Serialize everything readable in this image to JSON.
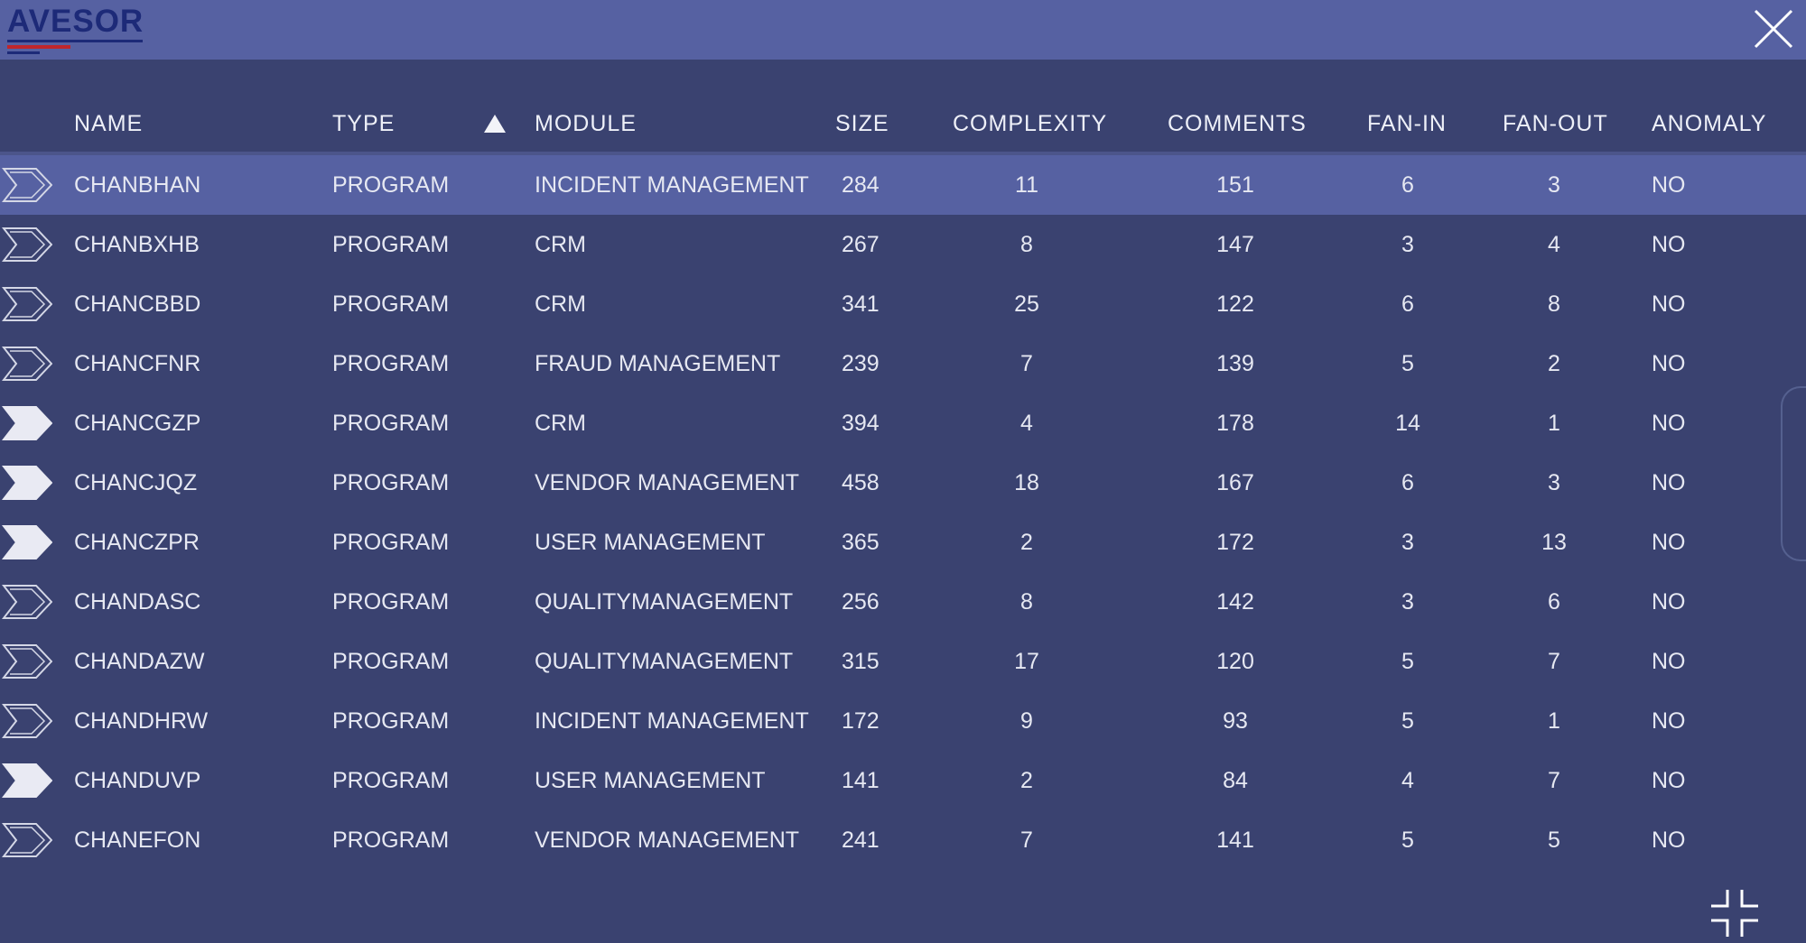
{
  "app": {
    "logo_text": "AVESOR",
    "close_icon": "close-icon",
    "collapse_icon": "collapse-icon"
  },
  "colors": {
    "background": "#3a4270",
    "header_bar": "#5661a2",
    "selected_row": "#5661a2",
    "text": "#e6e8f2",
    "logo_blue": "#1d2a78",
    "logo_red": "#c0262c"
  },
  "table": {
    "columns": [
      {
        "key": "name",
        "label": "NAME"
      },
      {
        "key": "type",
        "label": "TYPE"
      },
      {
        "key": "module",
        "label": "MODULE"
      },
      {
        "key": "size",
        "label": "SIZE"
      },
      {
        "key": "complexity",
        "label": "COMPLEXITY"
      },
      {
        "key": "comments",
        "label": "COMMENTS"
      },
      {
        "key": "fan_in",
        "label": "FAN-IN"
      },
      {
        "key": "fan_out",
        "label": "FAN-OUT"
      },
      {
        "key": "anomaly",
        "label": "ANOMALY"
      }
    ],
    "sort": {
      "column": "type",
      "direction": "ascending",
      "icon": "sort-ascending-icon"
    },
    "rows": [
      {
        "marker": "outline",
        "selected": true,
        "name": "CHANBHAN",
        "type": "PROGRAM",
        "module": "INCIDENT MANAGEMENT",
        "size": "284",
        "complexity": "11",
        "comments": "151",
        "fan_in": "6",
        "fan_out": "3",
        "anomaly": "NO"
      },
      {
        "marker": "outline",
        "selected": false,
        "name": "CHANBXHB",
        "type": "PROGRAM",
        "module": "CRM",
        "size": "267",
        "complexity": "8",
        "comments": "147",
        "fan_in": "3",
        "fan_out": "4",
        "anomaly": "NO"
      },
      {
        "marker": "outline",
        "selected": false,
        "name": "CHANCBBD",
        "type": "PROGRAM",
        "module": "CRM",
        "size": "341",
        "complexity": "25",
        "comments": "122",
        "fan_in": "6",
        "fan_out": "8",
        "anomaly": "NO"
      },
      {
        "marker": "outline",
        "selected": false,
        "name": "CHANCFNR",
        "type": "PROGRAM",
        "module": "FRAUD MANAGEMENT",
        "size": "239",
        "complexity": "7",
        "comments": "139",
        "fan_in": "5",
        "fan_out": "2",
        "anomaly": "NO"
      },
      {
        "marker": "filled",
        "selected": false,
        "name": "CHANCGZP",
        "type": "PROGRAM",
        "module": "CRM",
        "size": "394",
        "complexity": "4",
        "comments": "178",
        "fan_in": "14",
        "fan_out": "1",
        "anomaly": "NO"
      },
      {
        "marker": "filled",
        "selected": false,
        "name": "CHANCJQZ",
        "type": "PROGRAM",
        "module": "VENDOR MANAGEMENT",
        "size": "458",
        "complexity": "18",
        "comments": "167",
        "fan_in": "6",
        "fan_out": "3",
        "anomaly": "NO"
      },
      {
        "marker": "filled",
        "selected": false,
        "name": "CHANCZPR",
        "type": "PROGRAM",
        "module": "USER MANAGEMENT",
        "size": "365",
        "complexity": "2",
        "comments": "172",
        "fan_in": "3",
        "fan_out": "13",
        "anomaly": "NO"
      },
      {
        "marker": "outline",
        "selected": false,
        "name": "CHANDASC",
        "type": "PROGRAM",
        "module": "QUALITYMANAGEMENT",
        "size": "256",
        "complexity": "8",
        "comments": "142",
        "fan_in": "3",
        "fan_out": "6",
        "anomaly": "NO"
      },
      {
        "marker": "outline",
        "selected": false,
        "name": "CHANDAZW",
        "type": "PROGRAM",
        "module": "QUALITYMANAGEMENT",
        "size": "315",
        "complexity": "17",
        "comments": "120",
        "fan_in": "5",
        "fan_out": "7",
        "anomaly": "NO"
      },
      {
        "marker": "outline",
        "selected": false,
        "name": "CHANDHRW",
        "type": "PROGRAM",
        "module": "INCIDENT MANAGEMENT",
        "size": "172",
        "complexity": "9",
        "comments": "93",
        "fan_in": "5",
        "fan_out": "1",
        "anomaly": "NO"
      },
      {
        "marker": "filled",
        "selected": false,
        "name": "CHANDUVP",
        "type": "PROGRAM",
        "module": "USER MANAGEMENT",
        "size": "141",
        "complexity": "2",
        "comments": "84",
        "fan_in": "4",
        "fan_out": "7",
        "anomaly": "NO"
      },
      {
        "marker": "outline",
        "selected": false,
        "name": "CHANEFON",
        "type": "PROGRAM",
        "module": "VENDOR MANAGEMENT",
        "size": "241",
        "complexity": "7",
        "comments": "141",
        "fan_in": "5",
        "fan_out": "5",
        "anomaly": "NO"
      }
    ]
  }
}
